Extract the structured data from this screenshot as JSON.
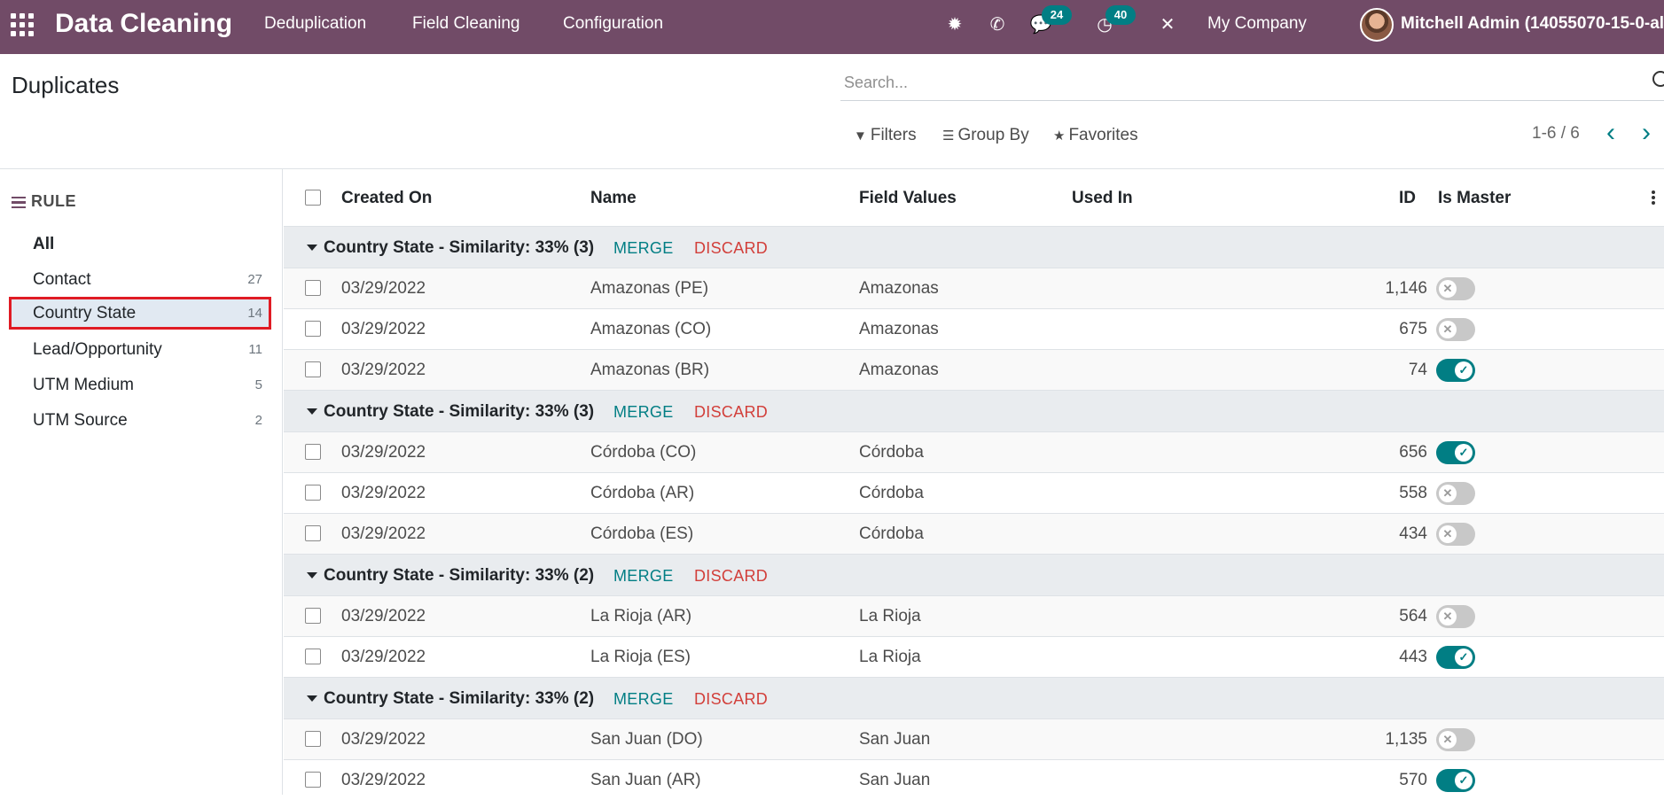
{
  "navbar": {
    "app_title": "Data Cleaning",
    "menus": [
      "Deduplication",
      "Field Cleaning",
      "Configuration"
    ],
    "messages_count": "24",
    "activities_count": "40",
    "company": "My Company",
    "user": "Mitchell Admin (14055070-15-0-all"
  },
  "control_panel": {
    "title": "Duplicates",
    "search_placeholder": "Search...",
    "filters_label": "Filters",
    "group_by_label": "Group By",
    "favorites_label": "Favorites",
    "pager": "1-6 / 6"
  },
  "sidebar": {
    "heading": "RULE",
    "items": [
      {
        "label": "All",
        "count": ""
      },
      {
        "label": "Contact",
        "count": "27"
      },
      {
        "label": "Country State",
        "count": "14"
      },
      {
        "label": "Lead/Opportunity",
        "count": "11"
      },
      {
        "label": "UTM Medium",
        "count": "5"
      },
      {
        "label": "UTM Source",
        "count": "2"
      }
    ]
  },
  "table": {
    "headers": {
      "created_on": "Created On",
      "name": "Name",
      "field_values": "Field Values",
      "used_in": "Used In",
      "id": "ID",
      "is_master": "Is Master"
    },
    "merge_label": "MERGE",
    "discard_label": "DISCARD",
    "groups": [
      {
        "title": "Country State - Similarity: 33% (3)",
        "rows": [
          {
            "created_on": "03/29/2022",
            "name": "Amazonas (PE)",
            "field_values": "Amazonas",
            "used_in": "",
            "id": "1,146",
            "is_master": false
          },
          {
            "created_on": "03/29/2022",
            "name": "Amazonas (CO)",
            "field_values": "Amazonas",
            "used_in": "",
            "id": "675",
            "is_master": false
          },
          {
            "created_on": "03/29/2022",
            "name": "Amazonas (BR)",
            "field_values": "Amazonas",
            "used_in": "",
            "id": "74",
            "is_master": true
          }
        ]
      },
      {
        "title": "Country State - Similarity: 33% (3)",
        "rows": [
          {
            "created_on": "03/29/2022",
            "name": "Córdoba (CO)",
            "field_values": "Córdoba",
            "used_in": "",
            "id": "656",
            "is_master": true
          },
          {
            "created_on": "03/29/2022",
            "name": "Córdoba (AR)",
            "field_values": "Córdoba",
            "used_in": "",
            "id": "558",
            "is_master": false
          },
          {
            "created_on": "03/29/2022",
            "name": "Córdoba (ES)",
            "field_values": "Córdoba",
            "used_in": "",
            "id": "434",
            "is_master": false
          }
        ]
      },
      {
        "title": "Country State - Similarity: 33% (2)",
        "rows": [
          {
            "created_on": "03/29/2022",
            "name": "La Rioja (AR)",
            "field_values": "La Rioja",
            "used_in": "",
            "id": "564",
            "is_master": false
          },
          {
            "created_on": "03/29/2022",
            "name": "La Rioja (ES)",
            "field_values": "La Rioja",
            "used_in": "",
            "id": "443",
            "is_master": true
          }
        ]
      },
      {
        "title": "Country State - Similarity: 33% (2)",
        "rows": [
          {
            "created_on": "03/29/2022",
            "name": "San Juan (DO)",
            "field_values": "San Juan",
            "used_in": "",
            "id": "1,135",
            "is_master": false
          },
          {
            "created_on": "03/29/2022",
            "name": "San Juan (AR)",
            "field_values": "San Juan",
            "used_in": "",
            "id": "570",
            "is_master": true
          }
        ]
      }
    ]
  },
  "colors": {
    "navbar": "#714b67",
    "accent": "#017e84",
    "discard": "#d23f3a",
    "highlight_border": "#e01b24"
  }
}
